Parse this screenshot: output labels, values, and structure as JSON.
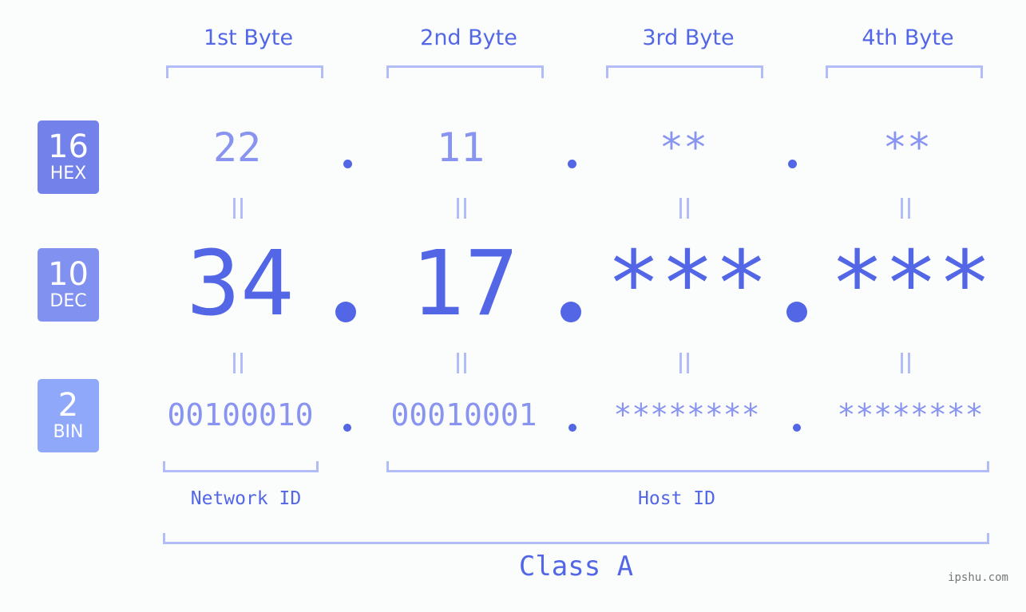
{
  "bytes": [
    {
      "title": "1st Byte",
      "hex": "22",
      "dec": "34",
      "bin": "00100010"
    },
    {
      "title": "2nd Byte",
      "hex": "11",
      "dec": "17",
      "bin": "00010001"
    },
    {
      "title": "3rd Byte",
      "hex": "**",
      "dec": "***",
      "bin": "********"
    },
    {
      "title": "4th Byte",
      "hex": "**",
      "dec": "***",
      "bin": "********"
    }
  ],
  "bases": [
    {
      "num": "16",
      "label": "HEX",
      "color": "#7381ea"
    },
    {
      "num": "10",
      "label": "DEC",
      "color": "#8191f0"
    },
    {
      "num": "2",
      "label": "BIN",
      "color": "#8fa8fa"
    }
  ],
  "separator": ".",
  "network_id_label": "Network ID",
  "host_id_label": "Host ID",
  "class_label": "Class A",
  "watermark": "ipshu.com",
  "colors": {
    "primary": "#5367e6",
    "light": "#8894ef",
    "bracket": "#b2bdf7"
  }
}
